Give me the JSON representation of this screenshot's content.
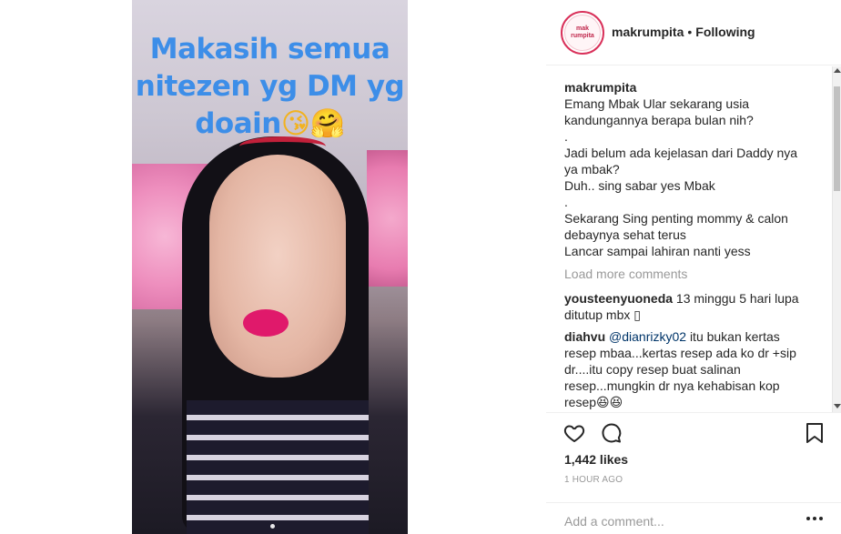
{
  "media": {
    "overlay_line1": "Makasih semua",
    "overlay_line2": "nitezen yg DM yg",
    "overlay_line3": "doain",
    "overlay_emoji": "😘🤗"
  },
  "header": {
    "avatar_text": "mak rumpita",
    "username": "makrumpita",
    "separator": "•",
    "follow_status": "Following"
  },
  "caption": {
    "author": "makrumpita",
    "lines": [
      "Emang Mbak Ular sekarang usia kandungannya berapa bulan nih?",
      ".",
      "Jadi belum ada kejelasan dari Daddy nya ya mbak?",
      "Duh.. sing sabar yes Mbak",
      ".",
      "Sekarang Sing penting mommy & calon debaynya sehat terus",
      "Lancar sampai lahiran nanti yess"
    ]
  },
  "comments": {
    "load_more": "Load more comments",
    "items": [
      {
        "author": "yousteenyuoneda",
        "text": "13 minggu 5 hari lupa ditutup mbx ▯"
      },
      {
        "author": "diahvu",
        "mention": "@dianrizky02",
        "text": "itu bukan kertas resep mbaa...kertas resep ada ko dr +sip dr....itu copy resep buat salinan resep...mungkin dr nya kehabisan kop resep😆😆"
      }
    ]
  },
  "actions": {
    "likes": "1,442 likes",
    "time": "1 HOUR AGO",
    "add_comment_placeholder": "Add a comment..."
  },
  "icons": {
    "like": "heart-icon",
    "comment": "comment-bubble-icon",
    "save": "bookmark-icon",
    "more": "more-options-icon"
  }
}
